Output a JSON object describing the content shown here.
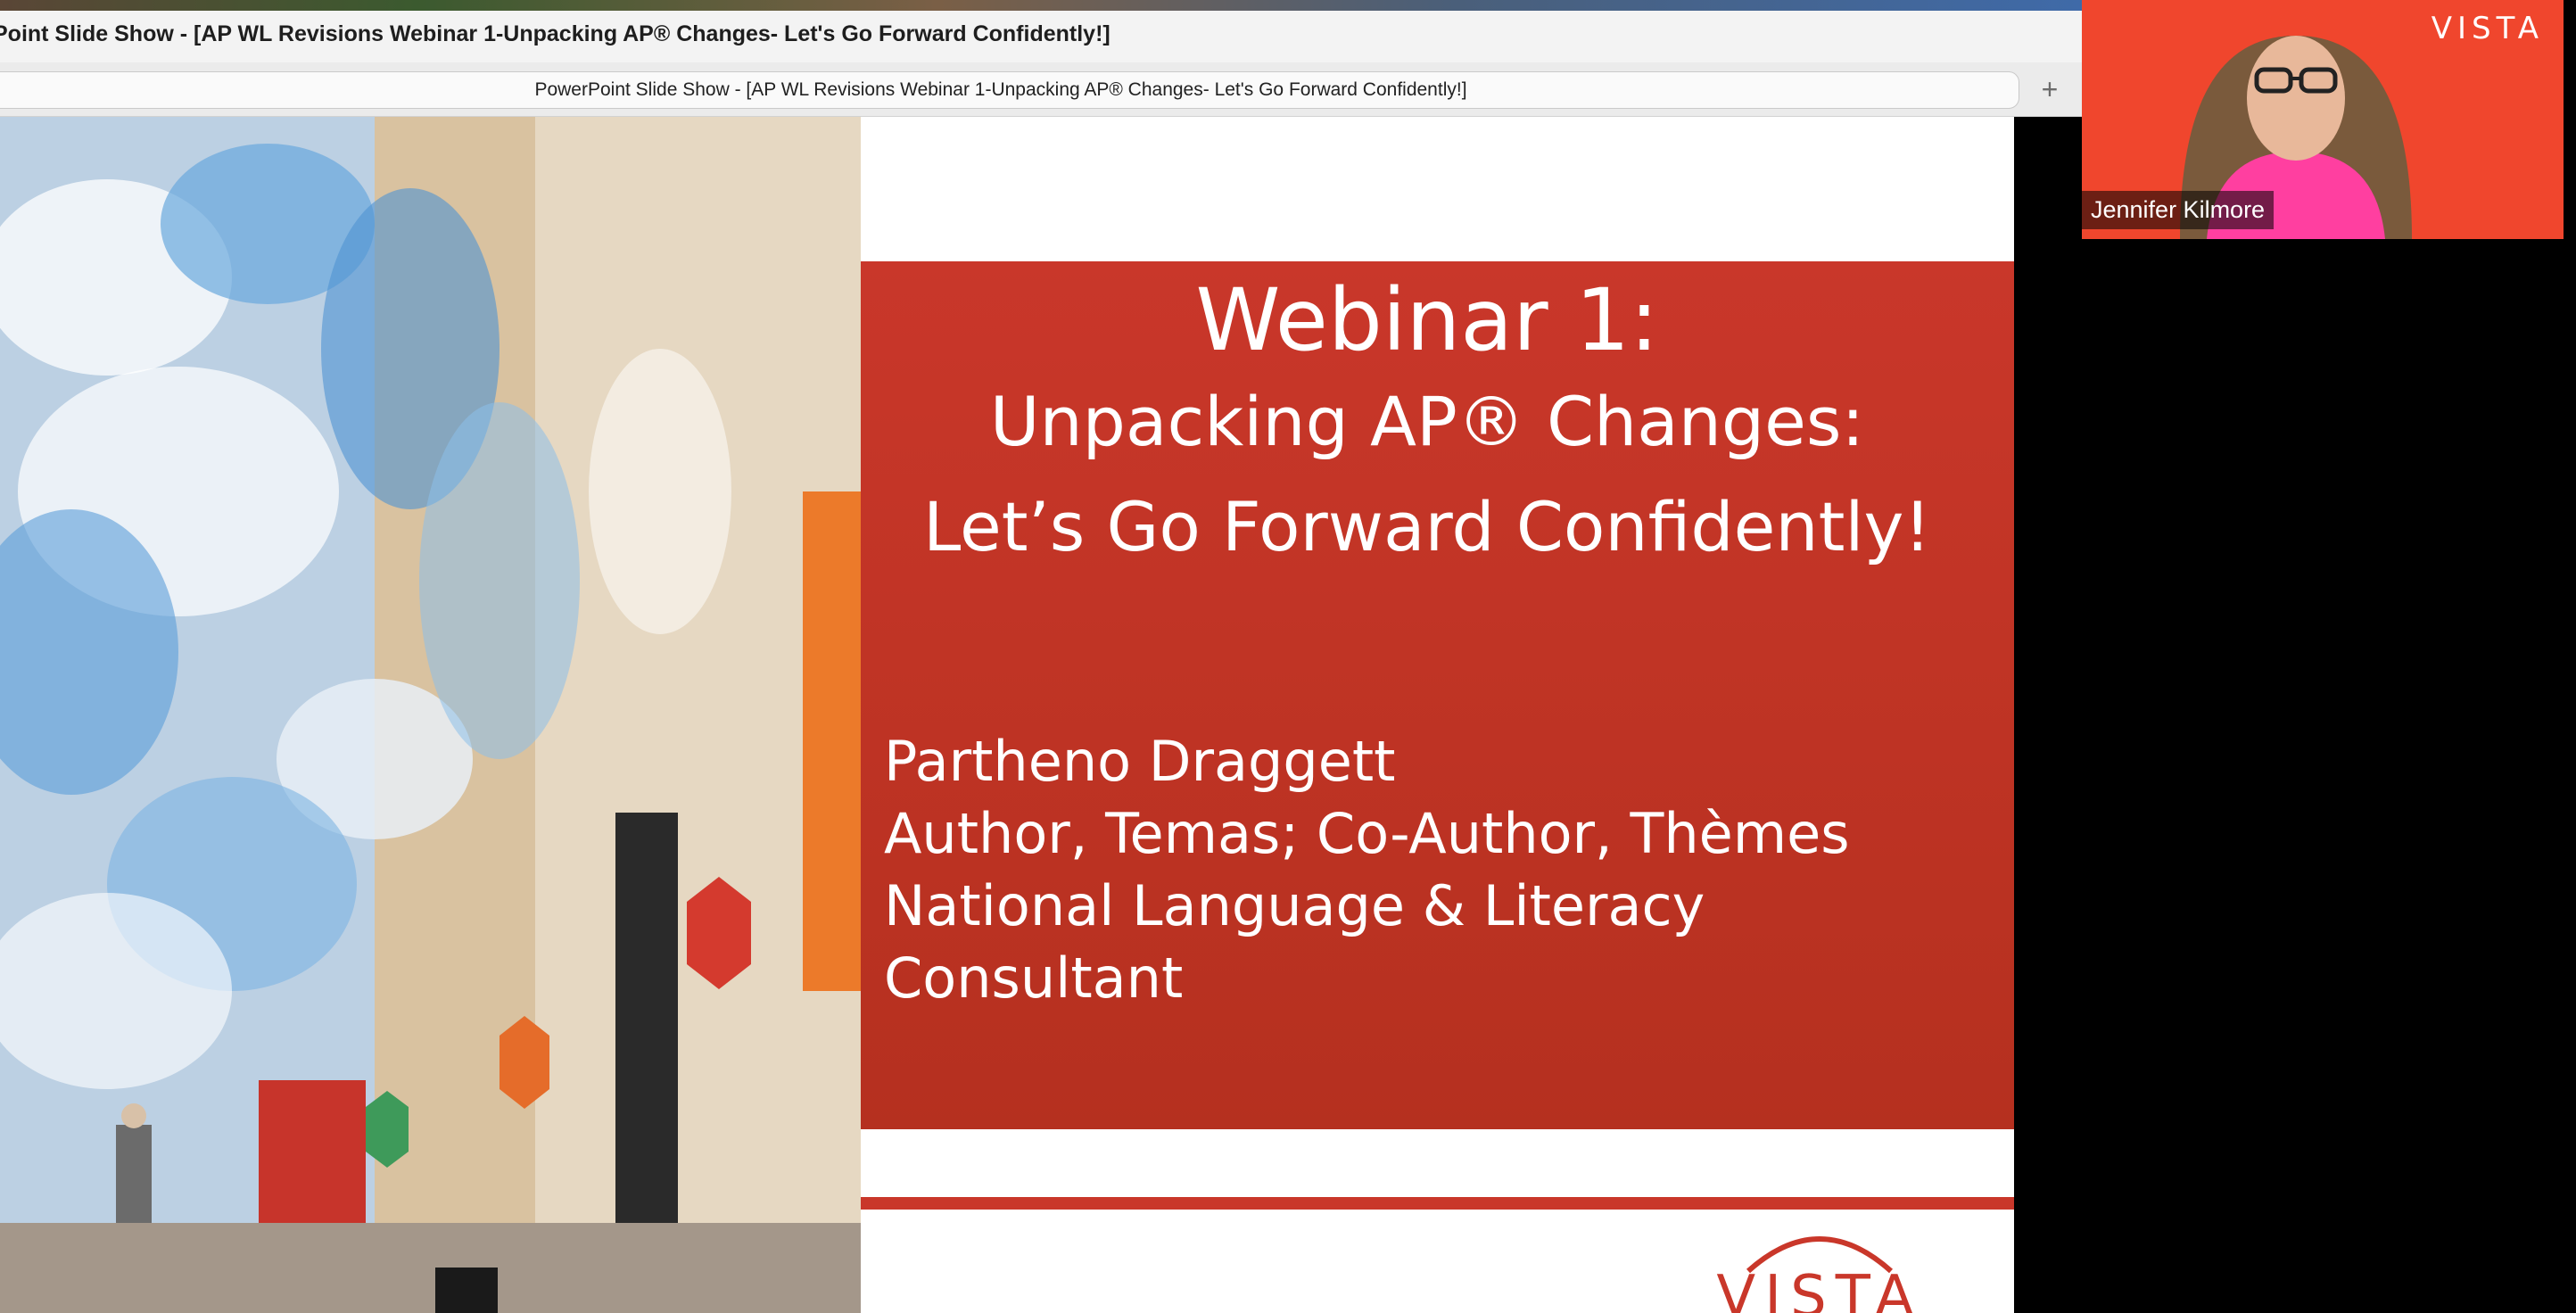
{
  "window": {
    "title": "Point Slide Show - [AP WL Revisions Webinar 1-Unpacking AP® Changes- Let's Go Forward Confidently!]",
    "tab_title": "PowerPoint Slide Show - [AP WL Revisions Webinar 1-Unpacking AP® Changes- Let's Go Forward Confidently!]",
    "new_tab_icon": "plus-icon"
  },
  "slide": {
    "title_line1": "Webinar 1:",
    "title_line2": "Unpacking AP® Changes:",
    "title_line3": "Let’s Go Forward Confidently!",
    "presenter_name": "Partheno Draggett",
    "presenter_role": "Author, Temas; Co-Author, Thèmes",
    "presenter_org_line1": "National Language & Literacy",
    "presenter_org_line2": "Consultant",
    "logo_text": "VISTA",
    "colors": {
      "banner": "#c9372a",
      "divider": "#c9372a"
    }
  },
  "video": {
    "participant_name": "Jennifer Kilmore",
    "brand": "VISTA",
    "background_color": "#f0462d"
  }
}
